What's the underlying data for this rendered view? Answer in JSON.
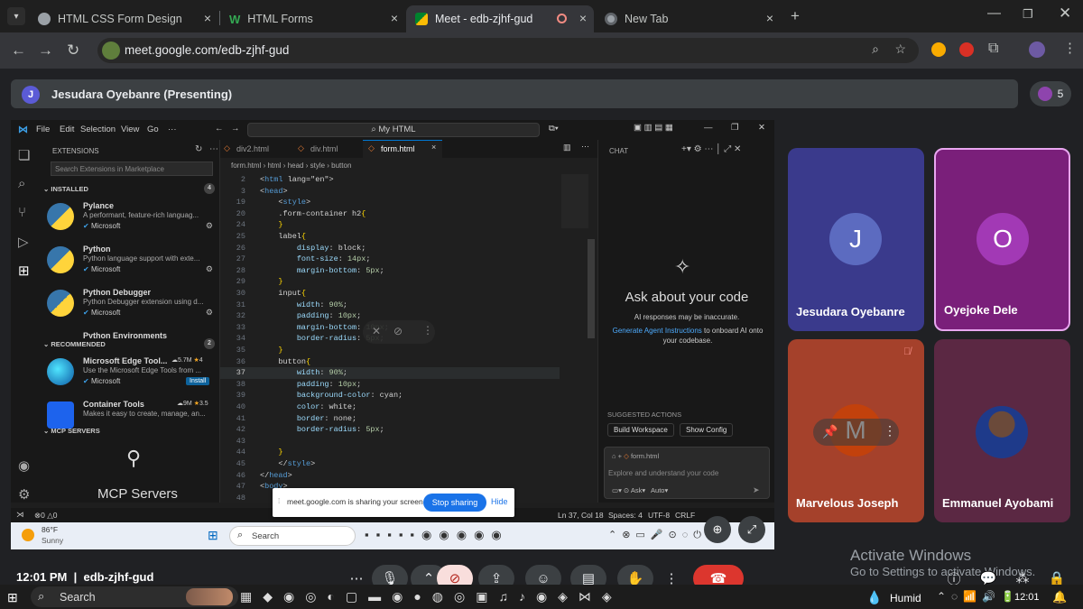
{
  "browser": {
    "tabs": [
      {
        "title": "HTML CSS Form Design",
        "icon": "web-icon"
      },
      {
        "title": "HTML Forms",
        "icon": "w-icon"
      },
      {
        "title": "Meet - edb-zjhf-gud",
        "icon": "meet-icon",
        "active": true
      },
      {
        "title": "New Tab",
        "icon": "chrome-icon"
      }
    ],
    "url": "meet.google.com/edb-zjhf-gud"
  },
  "meet": {
    "presenter_initial": "J",
    "presenting_label": "Jesudara Oyebanre (Presenting)",
    "participant_count": "5",
    "tiles": [
      {
        "name": "Jesudara Oyebanre",
        "initial": "J",
        "bg": "#3a3a8c",
        "avatar_color": "#5c6bc0"
      },
      {
        "name": "Oyejoke Dele",
        "initial": "O",
        "bg": "#7a1f7a",
        "avatar_color": "#a239b5"
      },
      {
        "name": "Marvelous Joseph",
        "initial": "M",
        "bg": "#a5412b",
        "avatar_color": "#c2410c"
      },
      {
        "name": "Emmanuel Ayobami",
        "initial": "",
        "bg": "#5b2843",
        "avatar_color": "#334155"
      }
    ],
    "time": "12:01 PM",
    "code": "edb-zjhf-gud",
    "activate_title": "Activate Windows",
    "activate_sub": "Go to Settings to activate Windows."
  },
  "vscode": {
    "menu": [
      "File",
      "Edit",
      "Selection",
      "View",
      "Go",
      "···"
    ],
    "search": "My HTML",
    "sidebar_title": "EXTENSIONS",
    "search_placeholder": "Search Extensions in Marketplace",
    "installed_label": "INSTALLED",
    "installed_count": "4",
    "recommended_label": "RECOMMENDED",
    "recommended_count": "2",
    "mcp_label": "MCP SERVERS",
    "mcp_title": "MCP Servers",
    "installed": [
      {
        "name": "Pylance",
        "desc": "A performant, feature-rich languag...",
        "pub": "Microsoft"
      },
      {
        "name": "Python",
        "desc": "Python language support with exte...",
        "pub": "Microsoft"
      },
      {
        "name": "Python Debugger",
        "desc": "Python Debugger extension using d...",
        "pub": "Microsoft"
      },
      {
        "name": "Python Environments",
        "desc": "",
        "pub": ""
      }
    ],
    "recommended": [
      {
        "name": "Microsoft Edge Tool...",
        "desc": "Use the Microsoft Edge Tools from ...",
        "pub": "Microsoft",
        "downloads": "5.7M",
        "rating": "4",
        "action": "Install"
      },
      {
        "name": "Container Tools",
        "desc": "Makes it easy to create, manage, an...",
        "pub": "",
        "downloads": "9M",
        "rating": "3.5"
      }
    ],
    "editor_tabs": [
      "div2.html",
      "div.html",
      "form.html"
    ],
    "breadcrumb": [
      "form.html",
      "html",
      "head",
      "style",
      "button"
    ],
    "code": [
      {
        "n": "2",
        "t": "<html lang=\"en\">"
      },
      {
        "n": "3",
        "t": "<head>"
      },
      {
        "n": "19",
        "t": "    <style>"
      },
      {
        "n": "20",
        "t": "    .form-container h2{"
      },
      {
        "n": "24",
        "t": "    }"
      },
      {
        "n": "25",
        "t": "    label{"
      },
      {
        "n": "26",
        "t": "        display: block;"
      },
      {
        "n": "27",
        "t": "        font-size: 14px;"
      },
      {
        "n": "28",
        "t": "        margin-bottom: 5px;"
      },
      {
        "n": "29",
        "t": "    }"
      },
      {
        "n": "30",
        "t": "    input{"
      },
      {
        "n": "31",
        "t": "        width: 90%;"
      },
      {
        "n": "32",
        "t": "        padding: 10px;"
      },
      {
        "n": "33",
        "t": "        margin-bottom: 10px;"
      },
      {
        "n": "34",
        "t": "        border-radius: 5px;"
      },
      {
        "n": "35",
        "t": "    }"
      },
      {
        "n": "36",
        "t": "    button{"
      },
      {
        "n": "37",
        "t": "        width: 90%;"
      },
      {
        "n": "38",
        "t": "        padding: 10px;"
      },
      {
        "n": "39",
        "t": "        background-color: cyan;"
      },
      {
        "n": "40",
        "t": "        color: white;"
      },
      {
        "n": "41",
        "t": "        border: none;"
      },
      {
        "n": "42",
        "t": "        border-radius: 5px;"
      },
      {
        "n": "43",
        "t": ""
      },
      {
        "n": "44",
        "t": "    }"
      },
      {
        "n": "45",
        "t": "    </style>"
      },
      {
        "n": "46",
        "t": "</head>"
      },
      {
        "n": "47",
        "t": "<body>"
      },
      {
        "n": "48",
        "t": ""
      }
    ],
    "chat_title": "CHAT",
    "chat_heading": "Ask about your code",
    "chat_disclaimer": "AI responses may be inaccurate.",
    "chat_link": "Generate Agent Instructions",
    "chat_link_rest": "to onboard AI onto your codebase.",
    "suggested_label": "SUGGESTED ACTIONS",
    "suggested": [
      "Build Workspace",
      "Show Config"
    ],
    "chat_file": "form.html",
    "chat_placeholder": "Explore and understand your code",
    "chat_mode": "Ask",
    "chat_model": "Auto",
    "status": {
      "errors": "0",
      "warnings": "0",
      "position": "Ln 37, Col 18",
      "spaces": "Spaces: 4",
      "encoding": "UTF-8",
      "eol": "CRLF"
    }
  },
  "share_banner": {
    "text": "meet.google.com is sharing your screen.",
    "stop": "Stop sharing",
    "hide": "Hide"
  },
  "inner_taskbar": {
    "temp": "86°F",
    "weather": "Sunny",
    "search": "Search"
  },
  "windows_taskbar": {
    "search": "Search",
    "weather": "Humid",
    "time": "12:01"
  }
}
